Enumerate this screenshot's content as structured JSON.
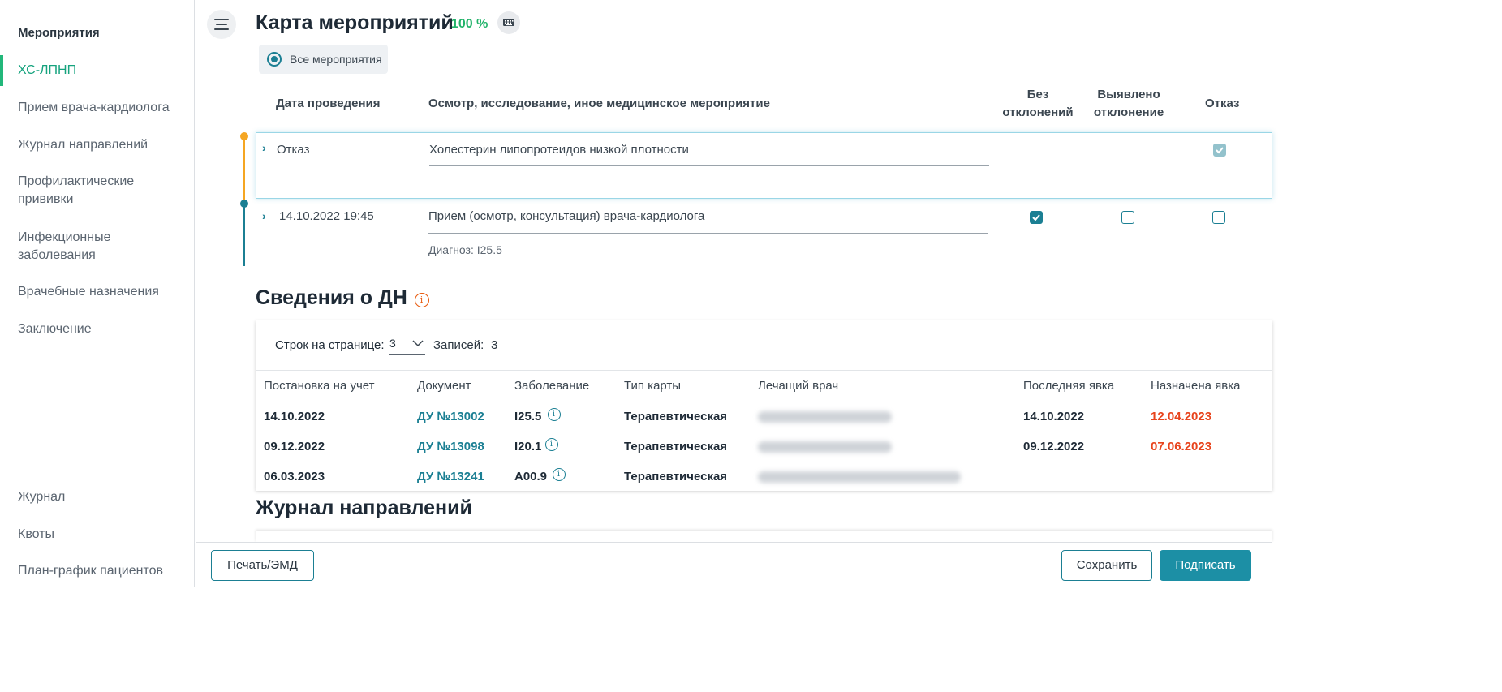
{
  "sidebar": {
    "title": "Мероприятия",
    "items": [
      {
        "label": "ХС-ЛПНП"
      },
      {
        "label": "Прием врача-кардиолога"
      },
      {
        "label": "Журнал направлений"
      },
      {
        "label": "Профилактические прививки"
      },
      {
        "label": "Инфекционные заболевания"
      },
      {
        "label": "Врачебные назначения"
      },
      {
        "label": "Заключение"
      }
    ],
    "bottom_items": [
      {
        "label": "Журнал"
      },
      {
        "label": "Квоты"
      },
      {
        "label": "План-график пациентов"
      }
    ]
  },
  "header": {
    "title": "Карта мероприятий",
    "percent": "100 %",
    "filter_label": "Все мероприятия"
  },
  "events_table": {
    "columns": {
      "date": "Дата проведения",
      "exam": "Осмотр, исследование, иное медицинское мероприятие",
      "no_dev_1": "Без",
      "no_dev_2": "отклонений",
      "dev_1": "Выявлено",
      "dev_2": "отклонение",
      "refusal": "Отказ"
    },
    "rows": [
      {
        "date": "Отказ",
        "exam": "Холестерин липопротеидов низкой плотности",
        "no_deviation": false,
        "deviation": false,
        "refusal": true
      },
      {
        "date": "14.10.2022 19:45",
        "exam": "Прием (осмотр, консультация) врача-кардиолога",
        "diagnosis": "Диагноз: I25.5",
        "no_deviation": true,
        "deviation": false,
        "refusal": false
      }
    ]
  },
  "dn": {
    "title": "Сведения о ДН",
    "rows_per_page_label": "Строк на странице:",
    "rows_per_page_value": "3",
    "records_label": "Записей:",
    "records_value": "3",
    "columns": [
      "Постановка на учет",
      "Документ",
      "Заболевание",
      "Тип карты",
      "Лечащий врач",
      "Последняя явка",
      "Назначена явка"
    ],
    "rows": [
      {
        "registered": "14.10.2022",
        "document": "ДУ №13002",
        "disease": "I25.5",
        "card_type": "Терапевтическая",
        "last_visit": "14.10.2022",
        "next_visit": "12.04.2023"
      },
      {
        "registered": "09.12.2022",
        "document": "ДУ №13098",
        "disease": "I20.1",
        "card_type": "Терапевтическая",
        "last_visit": "09.12.2022",
        "next_visit": "07.06.2023"
      },
      {
        "registered": "06.03.2023",
        "document": "ДУ №13241",
        "disease": "A00.9",
        "card_type": "Терапевтическая",
        "last_visit": "",
        "next_visit": ""
      }
    ]
  },
  "referrals": {
    "title": "Журнал направлений"
  },
  "footer": {
    "print_label": "Печать/ЭМД",
    "save_label": "Сохранить",
    "sign_label": "Подписать"
  },
  "colors": {
    "accent": "#1b7f93",
    "active_nav": "#16a37e",
    "warning": "#e8441d",
    "timeline_refusal": "#f5a623"
  }
}
